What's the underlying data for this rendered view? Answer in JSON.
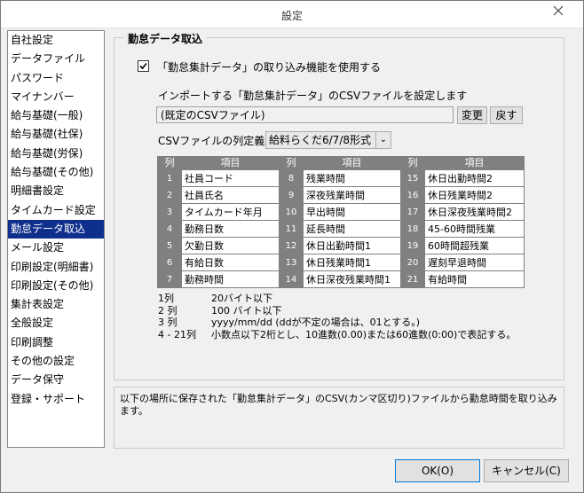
{
  "window": {
    "title": "設定"
  },
  "sidebar": {
    "items": [
      {
        "label": "自社設定"
      },
      {
        "label": "データファイル"
      },
      {
        "label": "パスワード"
      },
      {
        "label": "マイナンバー"
      },
      {
        "label": "給与基礎(一般)"
      },
      {
        "label": "給与基礎(社保)"
      },
      {
        "label": "給与基礎(労保)"
      },
      {
        "label": "給与基礎(その他)"
      },
      {
        "label": "明細書設定"
      },
      {
        "label": "タイムカード設定"
      },
      {
        "label": "勤怠データ取込"
      },
      {
        "label": "メール設定"
      },
      {
        "label": "印刷設定(明細書)"
      },
      {
        "label": "印刷設定(その他)"
      },
      {
        "label": "集計表設定"
      },
      {
        "label": "全般設定"
      },
      {
        "label": "印刷調整"
      },
      {
        "label": "その他の設定"
      },
      {
        "label": "データ保守"
      },
      {
        "label": "登録・サポート"
      }
    ],
    "selected_index": 10
  },
  "group": {
    "title": "勤怠データ取込",
    "checkbox_label": "「勤怠集計データ」の取り込み機能を使用する",
    "checkbox_checked": true,
    "import_label": "インポートする「勤怠集計データ」のCSVファイルを設定します",
    "path_value": "(既定のCSVファイル)",
    "change_button": "変更",
    "back_button": "戻す",
    "def_label": "CSVファイルの列定義",
    "def_select": "給料らくだ6/7/8形式"
  },
  "table": {
    "header_col": "列",
    "header_item": "項目",
    "rows": [
      [
        {
          "n": "1",
          "name": "社員コード"
        },
        {
          "n": "8",
          "name": "残業時間"
        },
        {
          "n": "15",
          "name": "休日出勤時間2"
        }
      ],
      [
        {
          "n": "2",
          "name": "社員氏名"
        },
        {
          "n": "9",
          "name": "深夜残業時間"
        },
        {
          "n": "16",
          "name": "休日残業時間2"
        }
      ],
      [
        {
          "n": "3",
          "name": "タイムカード年月"
        },
        {
          "n": "10",
          "name": "早出時間"
        },
        {
          "n": "17",
          "name": "休日深夜残業時間2"
        }
      ],
      [
        {
          "n": "4",
          "name": "勤務日数"
        },
        {
          "n": "11",
          "name": "延長時間"
        },
        {
          "n": "18",
          "name": "45-60時間残業"
        }
      ],
      [
        {
          "n": "5",
          "name": "欠勤日数"
        },
        {
          "n": "12",
          "name": "休日出勤時間1"
        },
        {
          "n": "19",
          "name": "60時間超残業"
        }
      ],
      [
        {
          "n": "6",
          "name": "有給日数"
        },
        {
          "n": "13",
          "name": "休日残業時間1"
        },
        {
          "n": "20",
          "name": "遅刻早退時間"
        }
      ],
      [
        {
          "n": "7",
          "name": "勤務時間"
        },
        {
          "n": "14",
          "name": "休日深夜残業時間1"
        },
        {
          "n": "21",
          "name": "有給時間"
        }
      ]
    ]
  },
  "notes": [
    {
      "col": "1列",
      "text": "20バイト以下"
    },
    {
      "col": "2 列",
      "text": "100 バイト以下"
    },
    {
      "col": "3 列",
      "text": "yyyy/mm/dd  (ddが不定の場合は、01とする。)"
    },
    {
      "col": "4 - 21列",
      "text": "小数点以下2桁とし、10進数(0.00)または60進数(0:00)で表記する。"
    }
  ],
  "description": "以下の場所に保存された「勤怠集計データ」のCSV(カンマ区切り)ファイルから勤怠時間を取り込みます。",
  "buttons": {
    "ok": "OK(O)",
    "cancel": "キャンセル(C)"
  },
  "colors": {
    "selection": "#0f2f8c",
    "table_bg": "#808080"
  }
}
